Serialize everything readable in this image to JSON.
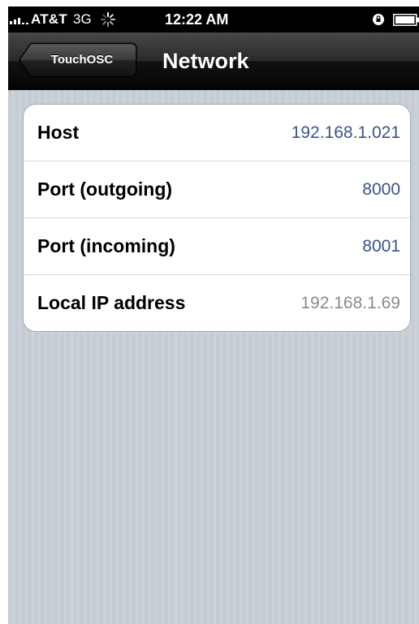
{
  "status_bar": {
    "carrier": "AT&T",
    "network_type": "3G",
    "time": "12:22 AM"
  },
  "nav": {
    "back_label": "TouchOSC",
    "title": "Network"
  },
  "rows": [
    {
      "label": "Host",
      "value": "192.168.1.021"
    },
    {
      "label": "Port (outgoing)",
      "value": "8000"
    },
    {
      "label": "Port (incoming)",
      "value": "8001"
    },
    {
      "label": "Local IP address",
      "value": "192.168.1.69"
    }
  ],
  "colors": {
    "nav_bar": "#1a1a1a",
    "background": "#c5ccd4",
    "editable_value": "#385487",
    "readonly_value": "#8b8b8b"
  }
}
